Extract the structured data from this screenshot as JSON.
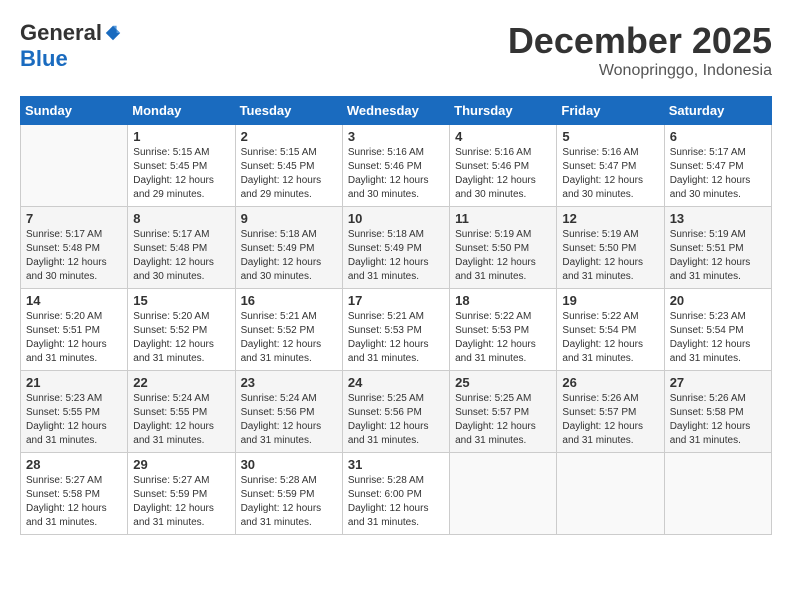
{
  "header": {
    "logo": {
      "general": "General",
      "blue": "Blue"
    },
    "title": "December 2025",
    "location": "Wonopringgo, Indonesia"
  },
  "days_of_week": [
    "Sunday",
    "Monday",
    "Tuesday",
    "Wednesday",
    "Thursday",
    "Friday",
    "Saturday"
  ],
  "weeks": [
    [
      {
        "day": "",
        "info": ""
      },
      {
        "day": "1",
        "info": "Sunrise: 5:15 AM\nSunset: 5:45 PM\nDaylight: 12 hours\nand 29 minutes."
      },
      {
        "day": "2",
        "info": "Sunrise: 5:15 AM\nSunset: 5:45 PM\nDaylight: 12 hours\nand 29 minutes."
      },
      {
        "day": "3",
        "info": "Sunrise: 5:16 AM\nSunset: 5:46 PM\nDaylight: 12 hours\nand 30 minutes."
      },
      {
        "day": "4",
        "info": "Sunrise: 5:16 AM\nSunset: 5:46 PM\nDaylight: 12 hours\nand 30 minutes."
      },
      {
        "day": "5",
        "info": "Sunrise: 5:16 AM\nSunset: 5:47 PM\nDaylight: 12 hours\nand 30 minutes."
      },
      {
        "day": "6",
        "info": "Sunrise: 5:17 AM\nSunset: 5:47 PM\nDaylight: 12 hours\nand 30 minutes."
      }
    ],
    [
      {
        "day": "7",
        "info": "Sunrise: 5:17 AM\nSunset: 5:48 PM\nDaylight: 12 hours\nand 30 minutes."
      },
      {
        "day": "8",
        "info": "Sunrise: 5:17 AM\nSunset: 5:48 PM\nDaylight: 12 hours\nand 30 minutes."
      },
      {
        "day": "9",
        "info": "Sunrise: 5:18 AM\nSunset: 5:49 PM\nDaylight: 12 hours\nand 30 minutes."
      },
      {
        "day": "10",
        "info": "Sunrise: 5:18 AM\nSunset: 5:49 PM\nDaylight: 12 hours\nand 31 minutes."
      },
      {
        "day": "11",
        "info": "Sunrise: 5:19 AM\nSunset: 5:50 PM\nDaylight: 12 hours\nand 31 minutes."
      },
      {
        "day": "12",
        "info": "Sunrise: 5:19 AM\nSunset: 5:50 PM\nDaylight: 12 hours\nand 31 minutes."
      },
      {
        "day": "13",
        "info": "Sunrise: 5:19 AM\nSunset: 5:51 PM\nDaylight: 12 hours\nand 31 minutes."
      }
    ],
    [
      {
        "day": "14",
        "info": "Sunrise: 5:20 AM\nSunset: 5:51 PM\nDaylight: 12 hours\nand 31 minutes."
      },
      {
        "day": "15",
        "info": "Sunrise: 5:20 AM\nSunset: 5:52 PM\nDaylight: 12 hours\nand 31 minutes."
      },
      {
        "day": "16",
        "info": "Sunrise: 5:21 AM\nSunset: 5:52 PM\nDaylight: 12 hours\nand 31 minutes."
      },
      {
        "day": "17",
        "info": "Sunrise: 5:21 AM\nSunset: 5:53 PM\nDaylight: 12 hours\nand 31 minutes."
      },
      {
        "day": "18",
        "info": "Sunrise: 5:22 AM\nSunset: 5:53 PM\nDaylight: 12 hours\nand 31 minutes."
      },
      {
        "day": "19",
        "info": "Sunrise: 5:22 AM\nSunset: 5:54 PM\nDaylight: 12 hours\nand 31 minutes."
      },
      {
        "day": "20",
        "info": "Sunrise: 5:23 AM\nSunset: 5:54 PM\nDaylight: 12 hours\nand 31 minutes."
      }
    ],
    [
      {
        "day": "21",
        "info": "Sunrise: 5:23 AM\nSunset: 5:55 PM\nDaylight: 12 hours\nand 31 minutes."
      },
      {
        "day": "22",
        "info": "Sunrise: 5:24 AM\nSunset: 5:55 PM\nDaylight: 12 hours\nand 31 minutes."
      },
      {
        "day": "23",
        "info": "Sunrise: 5:24 AM\nSunset: 5:56 PM\nDaylight: 12 hours\nand 31 minutes."
      },
      {
        "day": "24",
        "info": "Sunrise: 5:25 AM\nSunset: 5:56 PM\nDaylight: 12 hours\nand 31 minutes."
      },
      {
        "day": "25",
        "info": "Sunrise: 5:25 AM\nSunset: 5:57 PM\nDaylight: 12 hours\nand 31 minutes."
      },
      {
        "day": "26",
        "info": "Sunrise: 5:26 AM\nSunset: 5:57 PM\nDaylight: 12 hours\nand 31 minutes."
      },
      {
        "day": "27",
        "info": "Sunrise: 5:26 AM\nSunset: 5:58 PM\nDaylight: 12 hours\nand 31 minutes."
      }
    ],
    [
      {
        "day": "28",
        "info": "Sunrise: 5:27 AM\nSunset: 5:58 PM\nDaylight: 12 hours\nand 31 minutes."
      },
      {
        "day": "29",
        "info": "Sunrise: 5:27 AM\nSunset: 5:59 PM\nDaylight: 12 hours\nand 31 minutes."
      },
      {
        "day": "30",
        "info": "Sunrise: 5:28 AM\nSunset: 5:59 PM\nDaylight: 12 hours\nand 31 minutes."
      },
      {
        "day": "31",
        "info": "Sunrise: 5:28 AM\nSunset: 6:00 PM\nDaylight: 12 hours\nand 31 minutes."
      },
      {
        "day": "",
        "info": ""
      },
      {
        "day": "",
        "info": ""
      },
      {
        "day": "",
        "info": ""
      }
    ]
  ]
}
